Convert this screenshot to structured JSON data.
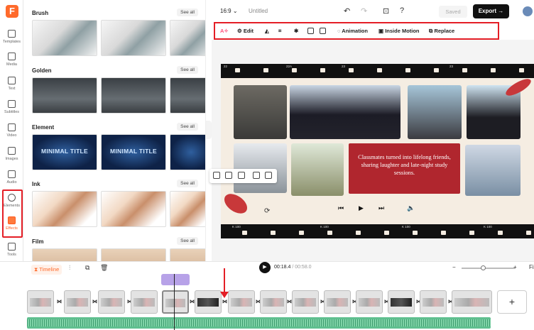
{
  "app": {
    "logo": "F",
    "title": "Untitled",
    "ratio": "16:9",
    "saved": "Saved",
    "export": "Export"
  },
  "rail": [
    {
      "label": "Templates",
      "icon": "templates-icon"
    },
    {
      "label": "Media",
      "icon": "media-icon"
    },
    {
      "label": "Text",
      "icon": "text-icon"
    },
    {
      "label": "Subtitles",
      "icon": "subtitles-icon"
    },
    {
      "label": "Video",
      "icon": "video-icon"
    },
    {
      "label": "Images",
      "icon": "images-icon"
    },
    {
      "label": "Audio",
      "icon": "audio-icon"
    },
    {
      "label": "Elements",
      "icon": "elements-icon"
    },
    {
      "label": "Effects",
      "icon": "effects-icon"
    },
    {
      "label": "Tools",
      "icon": "tools-icon"
    }
  ],
  "panel": {
    "see_all": "See all",
    "sections": [
      "Brush",
      "Golden",
      "Element",
      "Ink",
      "Film"
    ],
    "element_thumb_text": "MINIMAL TITLE"
  },
  "toolbar": {
    "edit": "Edit",
    "animation": "Animation",
    "inside_motion": "Inside Motion",
    "replace": "Replace"
  },
  "canvas": {
    "quote": "Classmates turned into lifelong friends, sharing laughter and late-night study sessions.",
    "strip_top_numbers": [
      "22",
      "22A",
      "23",
      "23"
    ],
    "strip_bottom_numbers": [
      "K 100",
      "K 100",
      "K 100",
      "K 100"
    ]
  },
  "timeline": {
    "label": "Timeline",
    "current": "00:18.4",
    "total": "/ 00:58.0",
    "fit": "Fi"
  },
  "colors": {
    "accent": "#ff6a2b",
    "highlight": "#e41e26",
    "quote_bg": "#b0262e",
    "audio": "#5fbf8f"
  }
}
